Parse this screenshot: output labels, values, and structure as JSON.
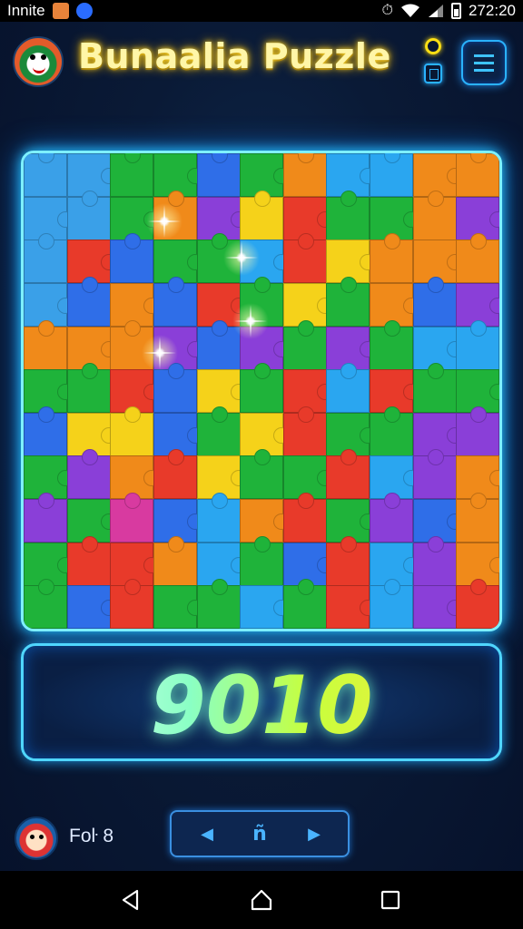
{
  "status_bar": {
    "app_name": "Innite",
    "time": "272:20",
    "icons": [
      "photo-notification-icon",
      "app-notification-icon",
      "alarm-icon",
      "wifi-icon",
      "signal-icon",
      "battery-icon"
    ]
  },
  "header": {
    "title": "Bunaalia Puzzle",
    "icons": [
      "app-logo",
      "coin-icon",
      "calculator-icon",
      "menu-icon"
    ]
  },
  "board": {
    "rows": 11,
    "cols": 11,
    "piece_colors": [
      [
        "#3aa0e8",
        "#3aa0e8",
        "#1fb33a",
        "#1fb33a",
        "#2f6ee8",
        "#1fb33a",
        "#f08a1a",
        "#2aa6f0",
        "#2aa6f0",
        "#f08a1a",
        "#f08a1a"
      ],
      [
        "#3aa0e8",
        "#3aa0e8",
        "#1fb33a",
        "#f08a1a",
        "#8a3fd8",
        "#f5d21a",
        "#e83a2a",
        "#1fb33a",
        "#1fb33a",
        "#f08a1a",
        "#8a3fd8"
      ],
      [
        "#3aa0e8",
        "#e83a2a",
        "#2f6ee8",
        "#1fb33a",
        "#1fb33a",
        "#2aa6f0",
        "#e83a2a",
        "#f5d21a",
        "#f08a1a",
        "#f08a1a",
        "#f08a1a"
      ],
      [
        "#3aa0e8",
        "#2f6ee8",
        "#f08a1a",
        "#2f6ee8",
        "#e83a2a",
        "#1fb33a",
        "#f5d21a",
        "#1fb33a",
        "#f08a1a",
        "#2f6ee8",
        "#8a3fd8"
      ],
      [
        "#f08a1a",
        "#f08a1a",
        "#f08a1a",
        "#8a3fd8",
        "#2f6ee8",
        "#8a3fd8",
        "#1fb33a",
        "#8a3fd8",
        "#1fb33a",
        "#2aa6f0",
        "#2aa6f0"
      ],
      [
        "#1fb33a",
        "#1fb33a",
        "#e83a2a",
        "#2f6ee8",
        "#f5d21a",
        "#1fb33a",
        "#e83a2a",
        "#2aa6f0",
        "#e83a2a",
        "#1fb33a",
        "#1fb33a"
      ],
      [
        "#2f6ee8",
        "#f5d21a",
        "#f5d21a",
        "#2f6ee8",
        "#1fb33a",
        "#f5d21a",
        "#e83a2a",
        "#1fb33a",
        "#1fb33a",
        "#8a3fd8",
        "#8a3fd8"
      ],
      [
        "#1fb33a",
        "#8a3fd8",
        "#f08a1a",
        "#e83a2a",
        "#f5d21a",
        "#1fb33a",
        "#1fb33a",
        "#e83a2a",
        "#2aa6f0",
        "#8a3fd8",
        "#f08a1a"
      ],
      [
        "#8a3fd8",
        "#1fb33a",
        "#d83aa0",
        "#2f6ee8",
        "#2aa6f0",
        "#f08a1a",
        "#e83a2a",
        "#1fb33a",
        "#8a3fd8",
        "#2f6ee8",
        "#f08a1a"
      ],
      [
        "#1fb33a",
        "#e83a2a",
        "#e83a2a",
        "#f08a1a",
        "#2aa6f0",
        "#1fb33a",
        "#2f6ee8",
        "#e83a2a",
        "#2aa6f0",
        "#8a3fd8",
        "#f08a1a"
      ],
      [
        "#1fb33a",
        "#2f6ee8",
        "#e83a2a",
        "#1fb33a",
        "#1fb33a",
        "#2aa6f0",
        "#1fb33a",
        "#e83a2a",
        "#2aa6f0",
        "#8a3fd8",
        "#e83a2a"
      ]
    ]
  },
  "score": {
    "value": "9010"
  },
  "footer": {
    "player_label": "Foŀ 8",
    "nav_prev_label": "◀",
    "nav_home_label": "ñ",
    "nav_next_label": "▶"
  },
  "system_nav": {
    "icons": [
      "back-icon",
      "home-icon",
      "recents-icon"
    ]
  }
}
